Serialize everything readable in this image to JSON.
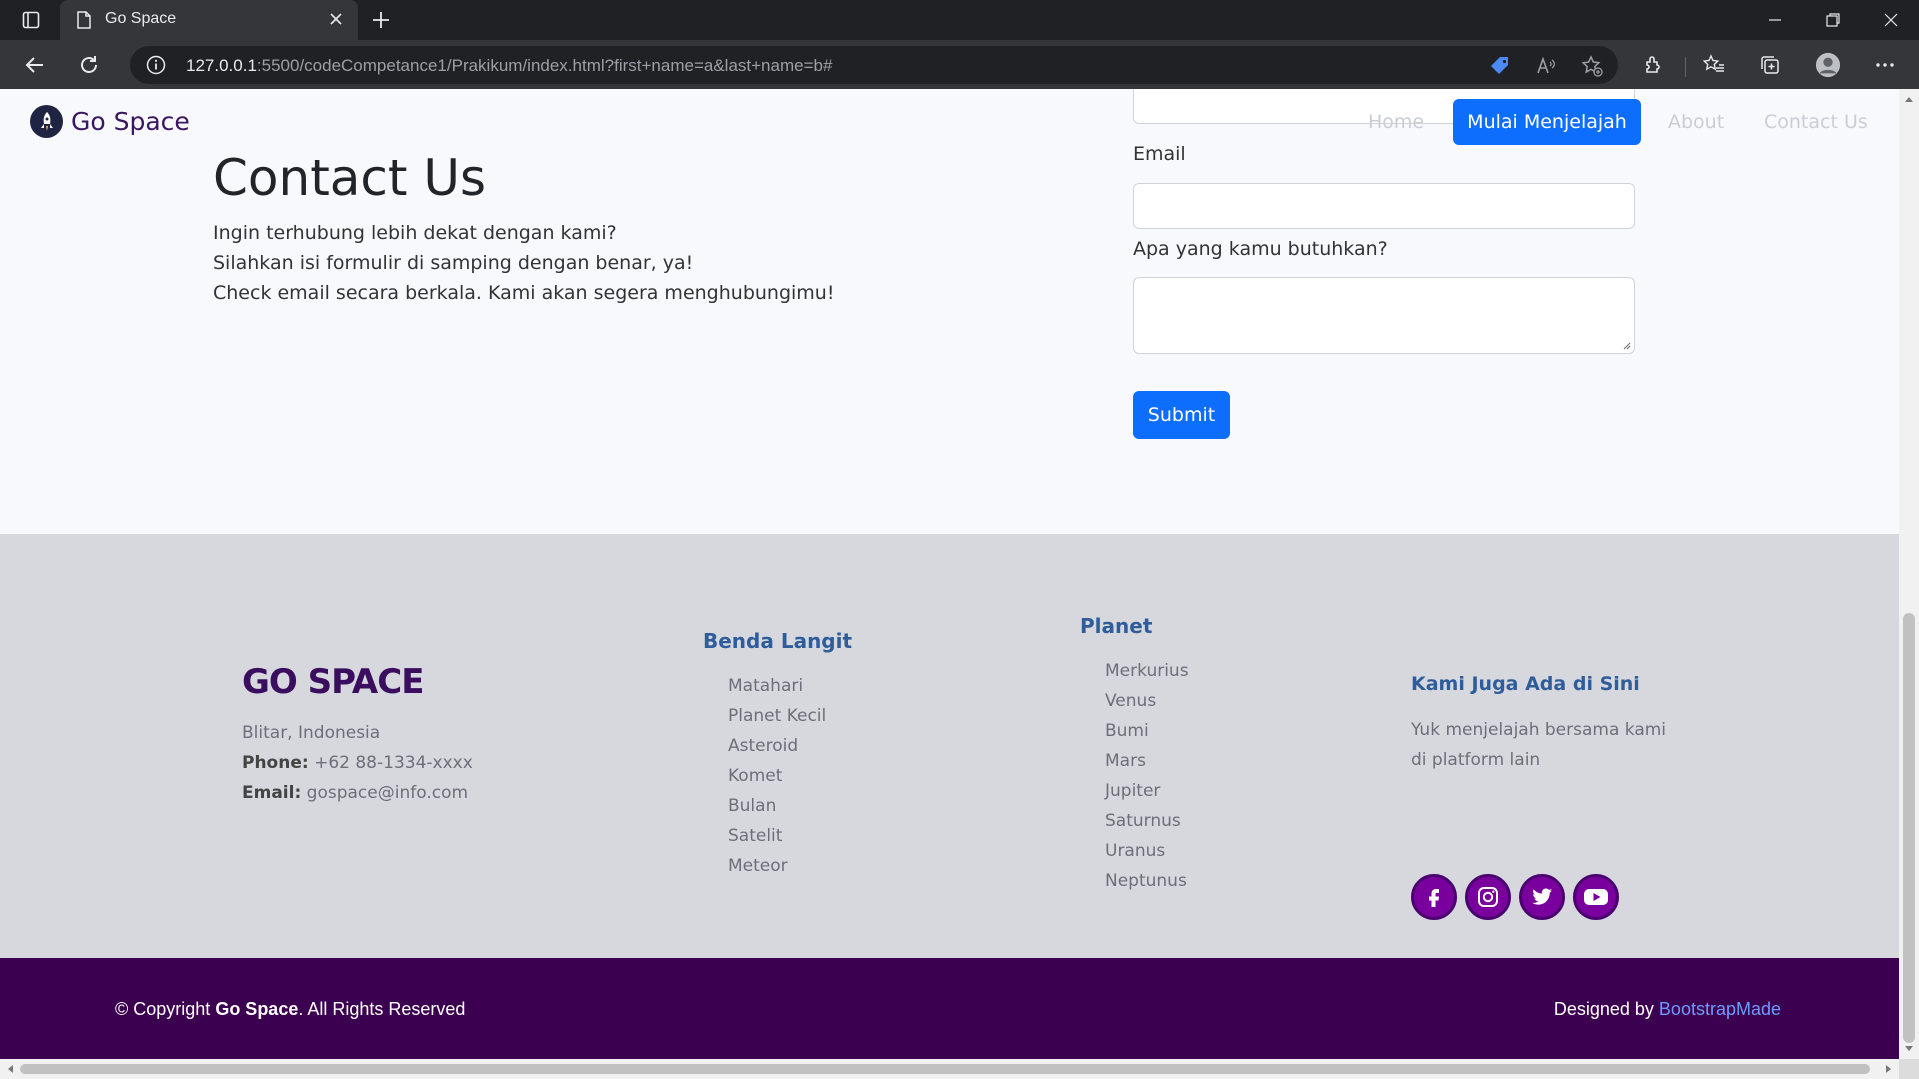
{
  "browser": {
    "tab_title": "Go Space",
    "url_host": "127.0.0.1",
    "url_rest": ":5500/codeCompetance1/Prakikum/index.html?first+name=a&last+name=b#"
  },
  "navbar": {
    "brand": "Go Space",
    "links": [
      "Home",
      "About",
      "Contact Us"
    ],
    "cta": "Mulai Menjelajah"
  },
  "contact": {
    "title": "Contact Us",
    "lines": [
      "Ingin terhubung lebih dekat dengan kami?",
      "Silahkan isi formulir di samping dengan benar, ya!",
      "Check email secara berkala. Kami akan segera menghubungimu!"
    ]
  },
  "form": {
    "email_label": "Email",
    "message_label": "Apa yang kamu butuhkan?",
    "submit": "Submit"
  },
  "footer": {
    "brand": "GO SPACE",
    "location": "Blitar, Indonesia",
    "phone_label": "Phone:",
    "phone": "+62 88-1334-xxxx",
    "email_label": "Email:",
    "email": "gospace@info.com",
    "benda_heading": "Benda Langit",
    "benda_items": [
      "Matahari",
      "Planet Kecil",
      "Asteroid",
      "Komet",
      "Bulan",
      "Satelit",
      "Meteor"
    ],
    "planet_heading": "Planet",
    "planet_items": [
      "Merkurius",
      "Venus",
      "Bumi",
      "Mars",
      "Jupiter",
      "Saturnus",
      "Uranus",
      "Neptunus"
    ],
    "social_heading": "Kami Juga Ada di Sini",
    "social_text_1": "Yuk menjelajah bersama kami",
    "social_text_2": "di platform lain",
    "social_icons": [
      "facebook-icon",
      "instagram-icon",
      "twitter-icon",
      "youtube-icon"
    ]
  },
  "bottom": {
    "copyright_prefix": "© Copyright ",
    "copyright_brand": "Go Space",
    "copyright_suffix": ". All Rights Reserved",
    "designed_by": "Designed by ",
    "designer": "BootstrapMade"
  },
  "colors": {
    "primary": "#0d6efd",
    "footer_dark": "#3c0050",
    "brand_purple": "#3a0d5e",
    "social_purple": "#7a009e",
    "heading_blue": "#2f5c9a"
  }
}
